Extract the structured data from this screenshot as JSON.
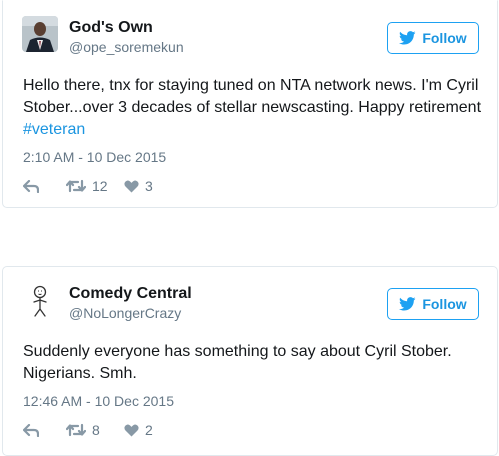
{
  "colors": {
    "follow_blue": "#1da1f2",
    "link_blue": "#1b95e0",
    "secondary_gray": "#657786",
    "border": "#e1e8ed"
  },
  "tweets": [
    {
      "name": "God's Own",
      "handle": "@ope_soremekun",
      "follow_label": "Follow",
      "text_before": "Hello there, tnx for staying tuned on NTA network news. I'm Cyril Stober...over 3 decades of stellar newscasting. Happy retirement ",
      "hashtag": "#veteran",
      "timestamp": "2:10 AM - 10 Dec 2015",
      "retweets": "12",
      "likes": "3",
      "avatar": "photo-of-man-in-suit"
    },
    {
      "name": "Comedy Central",
      "handle": "@NoLongerCrazy",
      "follow_label": "Follow",
      "text": "Suddenly everyone has something to say about Cyril Stober. Nigerians. Smh.",
      "timestamp": "12:46 AM - 10 Dec 2015",
      "retweets": "8",
      "likes": "2",
      "avatar": "stick-figure-sketch"
    }
  ],
  "icons": {
    "twitter": "twitter-bird-icon",
    "reply": "reply-icon",
    "retweet": "retweet-icon",
    "like": "heart-icon"
  }
}
